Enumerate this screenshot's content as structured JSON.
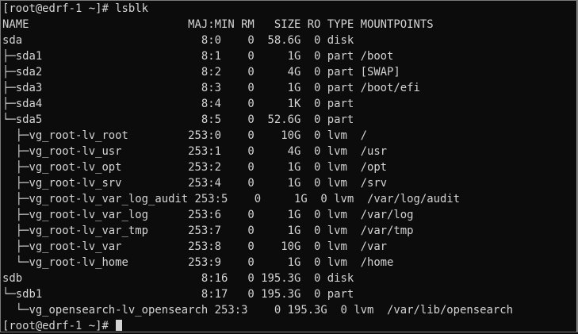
{
  "terminal": {
    "lines": [
      "[root@edrf-1 ~]# lsblk",
      "NAME                        MAJ:MIN RM   SIZE RO TYPE MOUNTPOINTS",
      "sda                           8:0    0  58.6G  0 disk",
      "├─sda1                        8:1    0     1G  0 part /boot",
      "├─sda2                        8:2    0     4G  0 part [SWAP]",
      "├─sda3                        8:3    0     1G  0 part /boot/efi",
      "├─sda4                        8:4    0     1K  0 part",
      "└─sda5                        8:5    0  52.6G  0 part",
      "  ├─vg_root-lv_root         253:0    0    10G  0 lvm  /",
      "  ├─vg_root-lv_usr          253:1    0     4G  0 lvm  /usr",
      "  ├─vg_root-lv_opt          253:2    0     1G  0 lvm  /opt",
      "  ├─vg_root-lv_srv          253:4    0     1G  0 lvm  /srv",
      "  ├─vg_root-lv_var_log_audit 253:5    0     1G  0 lvm  /var/log/audit",
      "  ├─vg_root-lv_var_log      253:6    0     1G  0 lvm  /var/log",
      "  ├─vg_root-lv_var_tmp      253:7    0     1G  0 lvm  /var/tmp",
      "  ├─vg_root-lv_var          253:8    0    10G  0 lvm  /var",
      "  └─vg_root-lv_home         253:9    0     1G  0 lvm  /home",
      "sdb                           8:16   0 195.3G  0 disk",
      "└─sdb1                        8:17   0 195.3G  0 part",
      "  └─vg_opensearch-lv_opensearch 253:3    0 195.3G  0 lvm  /var/lib/opensearch"
    ],
    "prompt": "[root@edrf-1 ~]# "
  },
  "colors": {
    "background": "#0c0c0c",
    "foreground": "#d4d4d4",
    "border": "#7a7a7a"
  }
}
